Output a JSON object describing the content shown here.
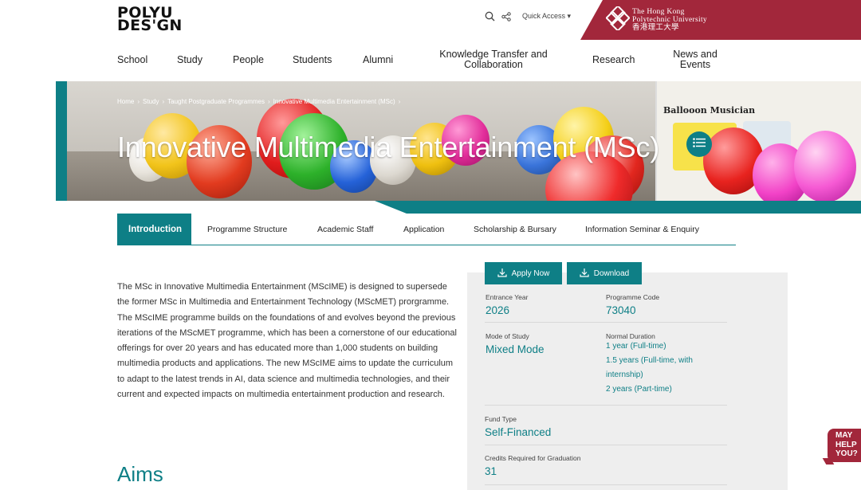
{
  "header": {
    "logo_line1": "POLYU",
    "logo_line2": "DES'GN",
    "quick_access": "Quick Access",
    "university_en_1": "The Hong Kong",
    "university_en_2": "Polytechnic University",
    "university_zh": "香港理工大學"
  },
  "nav": {
    "items": [
      "School",
      "Study",
      "People",
      "Students",
      "Alumni",
      "Knowledge Transfer and Collaboration",
      "Research",
      "News and Events"
    ]
  },
  "breadcrumb": [
    "Home",
    "Study",
    "Taught Postgraduate Programmes",
    "Innovative Multimedia Entertainment (MSc)"
  ],
  "hero": {
    "title": "Innovative Multimedia Entertainment (MSc)",
    "poster_title": "Ballooon Musician"
  },
  "tabs": [
    "Introduction",
    "Programme Structure",
    "Academic Staff",
    "Application",
    "Scholarship & Bursary",
    "Information Seminar & Enquiry"
  ],
  "intro": {
    "text": "The MSc in Innovative Multimedia Entertainment (MScIME) is designed to supersede the former MSc in Multimedia and Entertainment Technology (MScMET) prorgramme. The MScIME programme builds on the foundations of and evolves beyond the previous iterations of the MScMET programme, which has been a cornerstone of our educational offerings for over 20 years and has educated more than 1,000 students on building multimedia products and applications. The new MScIME aims to update the curriculum to adapt to the latest trends in AI, data science and multimedia technologies, and their current and expected impacts on multimedia entertainment production and research.",
    "aims_heading": "Aims"
  },
  "panel": {
    "apply_label": "Apply Now",
    "download_label": "Download",
    "entrance_year_label": "Entrance Year",
    "entrance_year": "2026",
    "programme_code_label": "Programme Code",
    "programme_code": "73040",
    "mode_label": "Mode of Study",
    "mode": "Mixed Mode",
    "duration_label": "Normal Duration",
    "duration_1": "1 year (Full-time)",
    "duration_2a": "1.5 years (Full-time, with",
    "duration_2b": "internship)",
    "duration_3": "2 years (Part-time)",
    "fund_label": "Fund Type",
    "fund": "Self-Financed",
    "credits_label": "Credits Required for Graduation",
    "credits": "31"
  },
  "help": {
    "line1": "MAY",
    "line2": "HELP",
    "line3": "YOU?"
  },
  "colors": {
    "teal": "#0e7f86",
    "brand_red": "#a2273b"
  }
}
